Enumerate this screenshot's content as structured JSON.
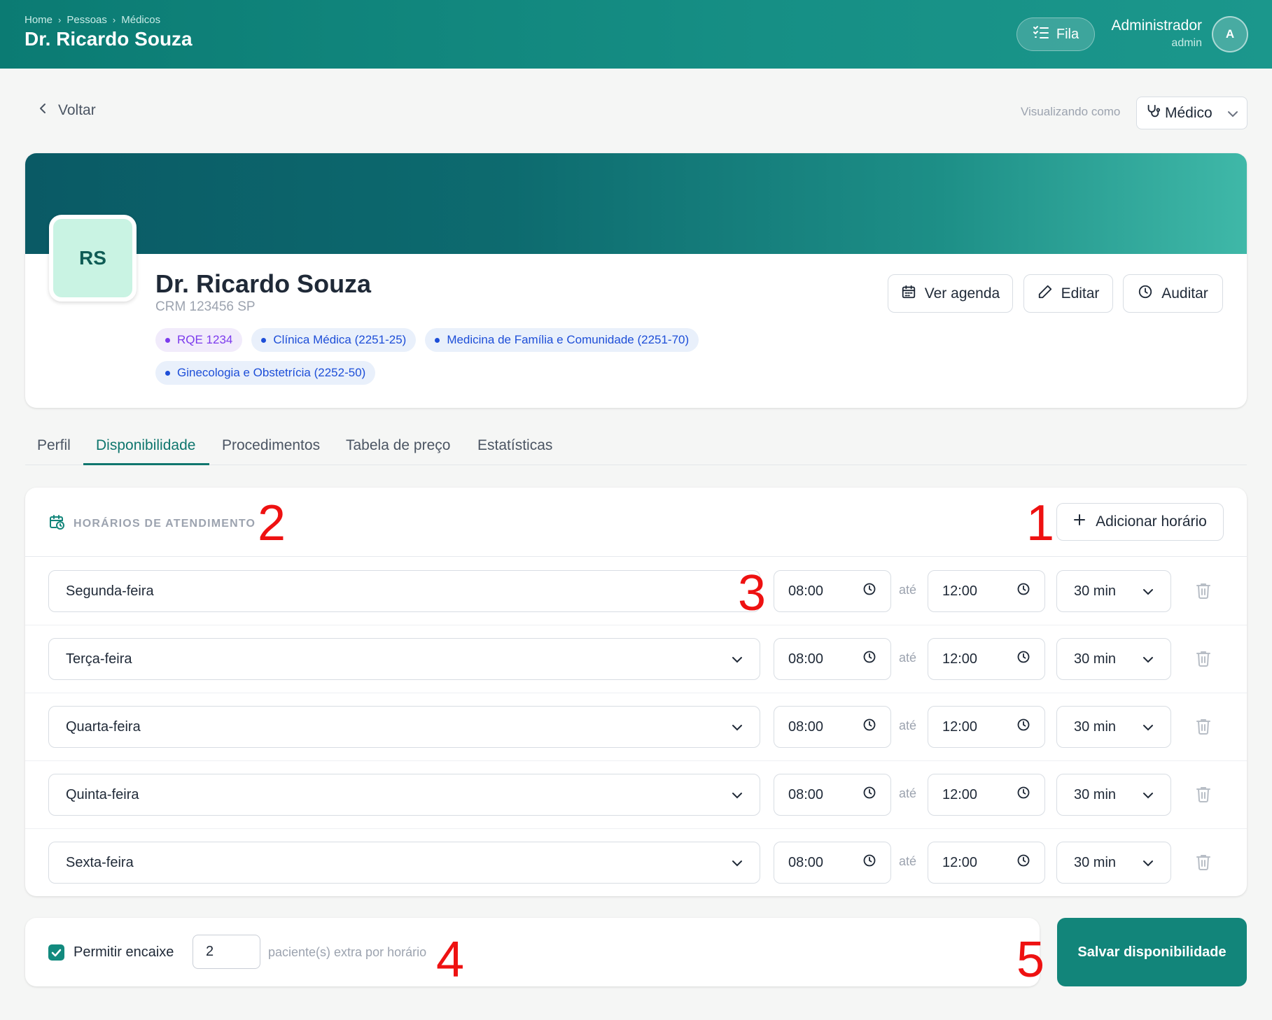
{
  "header": {
    "breadcrumb": [
      "Home",
      "Pessoas",
      "Médicos"
    ],
    "title": "Dr. Ricardo Souza",
    "queue_button": "Fila",
    "user_name": "Administrador",
    "user_role": "admin",
    "avatar_initial": "A"
  },
  "nav": {
    "back_label": "Voltar",
    "viewing_as_label": "Visualizando como",
    "viewing_as_value": "Médico"
  },
  "profile": {
    "initials": "RS",
    "name": "Dr. Ricardo Souza",
    "crm": "CRM 123456 SP",
    "tags": [
      {
        "label": "RQE 1234",
        "color": "#7c3aed"
      },
      {
        "label": "Clínica Médica (2251-25)",
        "color": "#1d4ed8"
      },
      {
        "label": "Medicina de Família e Comunidade (2251-70)",
        "color": "#1d4ed8"
      },
      {
        "label": "Ginecologia e Obstetrícia (2252-50)",
        "color": "#1d4ed8"
      }
    ],
    "actions": {
      "agenda": "Ver agenda",
      "edit": "Editar",
      "audit": "Auditar"
    }
  },
  "tabs": [
    {
      "label": "Perfil",
      "active": false
    },
    {
      "label": "Disponibilidade",
      "active": true
    },
    {
      "label": "Procedimentos",
      "active": false
    },
    {
      "label": "Tabela de preço",
      "active": false
    },
    {
      "label": "Estatísticas",
      "active": false
    }
  ],
  "schedule": {
    "section_title": "HORÁRIOS DE ATENDIMENTO",
    "add_button": "Adicionar horário",
    "separator": "até",
    "rows": [
      {
        "day": "Segunda-feira",
        "start": "08:00",
        "end": "12:00",
        "duration": "30 min"
      },
      {
        "day": "Terça-feira",
        "start": "08:00",
        "end": "12:00",
        "duration": "30 min"
      },
      {
        "day": "Quarta-feira",
        "start": "08:00",
        "end": "12:00",
        "duration": "30 min"
      },
      {
        "day": "Quinta-feira",
        "start": "08:00",
        "end": "12:00",
        "duration": "30 min"
      },
      {
        "day": "Sexta-feira",
        "start": "08:00",
        "end": "12:00",
        "duration": "30 min"
      }
    ]
  },
  "overbooking": {
    "checked": true,
    "label": "Permitir encaixe",
    "value": "2",
    "suffix": "paciente(s) extra por horário"
  },
  "save_button": "Salvar disponibilidade",
  "annotations": [
    "1",
    "2",
    "3",
    "4",
    "5"
  ],
  "colors": {
    "brand": "#12857a",
    "accent_tab": "#0f766e",
    "annotation": "#ee1111"
  }
}
